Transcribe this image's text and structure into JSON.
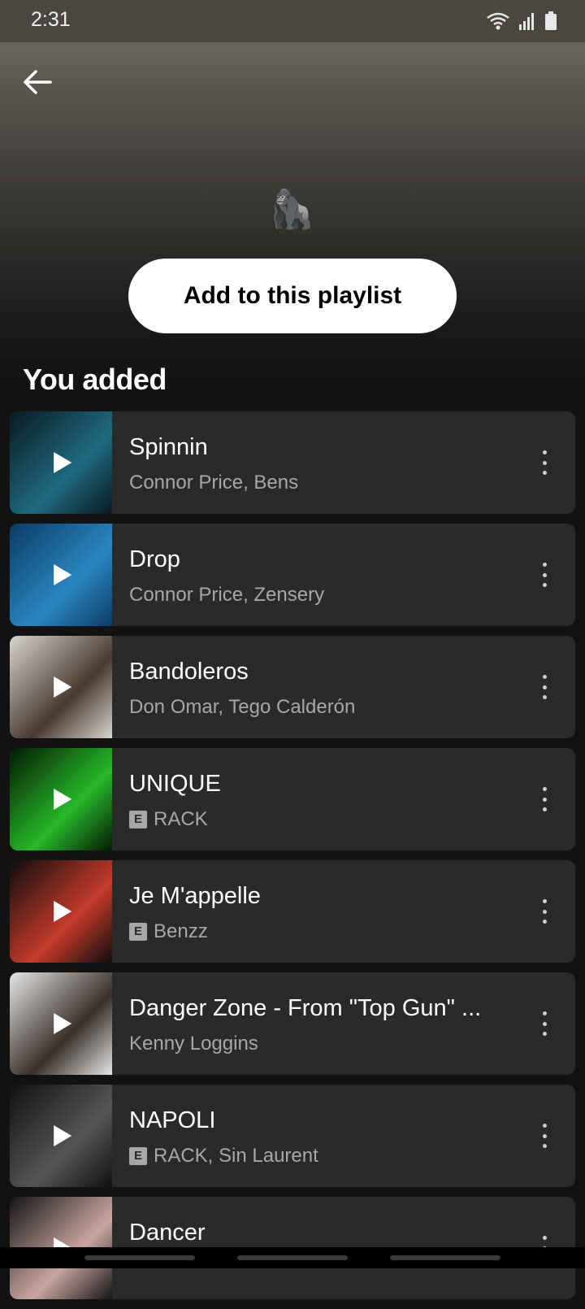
{
  "status_bar": {
    "time": "2:31"
  },
  "header": {
    "emoji": "🦍",
    "add_button_label": "Add to this playlist"
  },
  "section": {
    "title": "You added"
  },
  "tracks": [
    {
      "title": "Spinnin",
      "artist": "Connor Price, Bens",
      "explicit": false,
      "art_colors": [
        "#0a1a22",
        "#1f6a80"
      ]
    },
    {
      "title": "Drop",
      "artist": "Connor Price, Zensery",
      "explicit": false,
      "art_colors": [
        "#0b3b66",
        "#2a86c0"
      ]
    },
    {
      "title": "Bandoleros",
      "artist": "Don Omar, Tego Calderón",
      "explicit": false,
      "art_colors": [
        "#d8d5cf",
        "#4a3a30"
      ]
    },
    {
      "title": "UNIQUE",
      "artist": "RACK",
      "explicit": true,
      "art_colors": [
        "#051a05",
        "#27b82a"
      ]
    },
    {
      "title": "Je M'appelle",
      "artist": "Benzz",
      "explicit": true,
      "art_colors": [
        "#0e0e0e",
        "#c43a2a"
      ]
    },
    {
      "title": "Danger Zone - From \"Top Gun\" ...",
      "artist": "Kenny Loggins",
      "explicit": false,
      "art_colors": [
        "#e6e6e6",
        "#3a2f28"
      ]
    },
    {
      "title": "NAPOLI",
      "artist": "RACK, Sin Laurent",
      "explicit": true,
      "art_colors": [
        "#111111",
        "#555555"
      ]
    },
    {
      "title": "Dancer",
      "artist": "",
      "explicit": false,
      "art_colors": [
        "#151515",
        "#c9a6a0"
      ]
    }
  ],
  "icons": [
    "back-arrow-icon",
    "wifi-icon",
    "signal-icon",
    "battery-icon",
    "play-icon",
    "more-vertical-icon",
    "explicit-icon"
  ]
}
